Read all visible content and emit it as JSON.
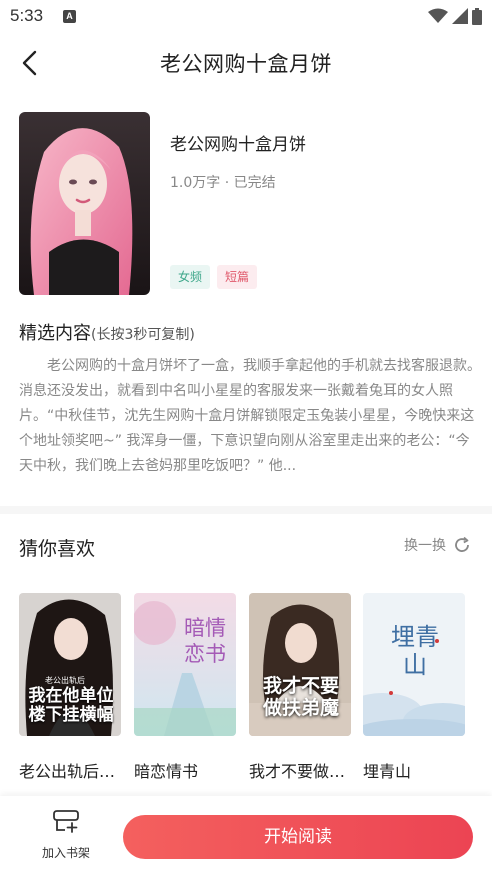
{
  "status_bar": {
    "time": "5:33",
    "indicator": "A"
  },
  "nav": {
    "title": "老公网购十盒月饼"
  },
  "book": {
    "title": "老公网购十盒月饼",
    "meta": "1.0万字 · 已完结",
    "tags": [
      "女频",
      "短篇"
    ],
    "tag_colors": [
      "#3ea78a",
      "#e05a6c"
    ]
  },
  "intro": {
    "heading": "精选内容",
    "hint": "(长按3秒可复制)",
    "text": "老公网购的十盒月饼坏了一盒，我顺手拿起他的手机就去找客服退款。　消息还没发出，就看到中名叫小星星的客服发来一张戴着兔耳的女人照片。“中秋佳节，沈先生网购十盒月饼解锁限定玉兔装小星星，今晚快来这个地址领奖吧~” 我浑身一僵，下意识望向刚从浴室里走出来的老公：“今天中秋，我们晚上去爸妈那里吃饭吧？” 他..."
  },
  "recommend": {
    "title": "猜你喜欢",
    "refresh_label": "换一换",
    "items": [
      {
        "name": "老公出轨后我在他单位楼下挂横幅",
        "cover_text_small": "老公出轨后",
        "cover_text": "我在他单位楼下挂横幅"
      },
      {
        "name": "暗恋情书",
        "cover_text": "暗情恋书"
      },
      {
        "name": "我才不要做扶弟魔",
        "cover_text": "我才不要做扶弟魔"
      },
      {
        "name": "埋青山",
        "cover_text": "埋青山"
      }
    ]
  },
  "bottom": {
    "shelf_label": "加入书架",
    "read_label": "开始阅读"
  },
  "colors": {
    "accent": "#ec4453",
    "muted": "#888888"
  }
}
